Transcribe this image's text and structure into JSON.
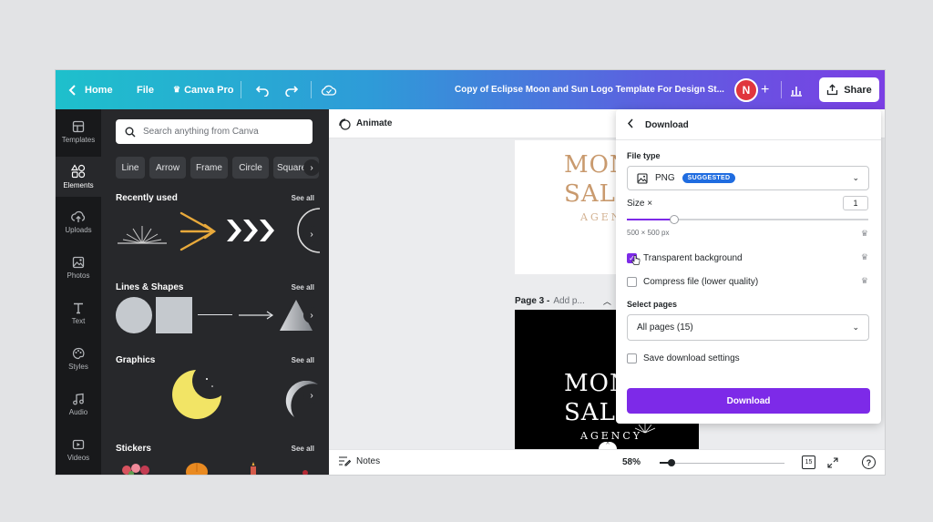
{
  "topbar": {
    "home_label": "Home",
    "file_label": "File",
    "canva_pro_label": "Canva Pro",
    "doc_title": "Copy of Eclipse Moon and Sun Logo Template For Design St...",
    "avatar_initial": "N",
    "add_label": "+",
    "share_label": "Share"
  },
  "rail": {
    "items": [
      {
        "label": "Templates",
        "icon": "templates-icon"
      },
      {
        "label": "Elements",
        "icon": "elements-icon"
      },
      {
        "label": "Uploads",
        "icon": "uploads-icon"
      },
      {
        "label": "Photos",
        "icon": "photos-icon"
      },
      {
        "label": "Text",
        "icon": "text-icon"
      },
      {
        "label": "Styles",
        "icon": "styles-icon"
      },
      {
        "label": "Audio",
        "icon": "audio-icon"
      },
      {
        "label": "Videos",
        "icon": "videos-icon"
      }
    ]
  },
  "panel": {
    "search_placeholder": "Search anything from Canva",
    "chips": [
      "Line",
      "Arrow",
      "Frame",
      "Circle",
      "Square"
    ],
    "sections": [
      {
        "title": "Recently used",
        "see_all": "See all"
      },
      {
        "title": "Lines & Shapes",
        "see_all": "See all"
      },
      {
        "title": "Graphics",
        "see_all": "See all"
      },
      {
        "title": "Stickers",
        "see_all": "See all"
      }
    ]
  },
  "canvas": {
    "animate_label": "Animate",
    "page_label": "Page 3 -",
    "page_title_placeholder": "Add p...",
    "logo_line1": "MON",
    "logo_line2": "SALL",
    "logo_line3": "AGENCY",
    "notes_label": "Notes",
    "zoom": "58%",
    "page_count": "15",
    "help_label": "?"
  },
  "download": {
    "title": "Download",
    "file_type_label": "File type",
    "file_type_value": "PNG",
    "suggested_badge": "SUGGESTED",
    "size_label": "Size ×",
    "size_value": "1",
    "dimensions": "500 × 500 px",
    "transparent_label": "Transparent background",
    "compress_label": "Compress file (lower quality)",
    "select_pages_label": "Select pages",
    "pages_value": "All pages (15)",
    "save_settings_label": "Save download settings",
    "download_button": "Download"
  },
  "colors": {
    "accent": "#7d2ae8",
    "badge": "#1f6ce0",
    "topbar_start": "#1ec0cc",
    "topbar_end": "#7b3fe4",
    "panel_bg": "#27282b",
    "rail_bg": "#18191b",
    "avatar": "#e0363d"
  },
  "state": {
    "size_slider_fraction": 0.2,
    "transparent_checked": true,
    "compress_checked": false,
    "save_settings_checked": false,
    "active_rail_item": "Elements"
  }
}
